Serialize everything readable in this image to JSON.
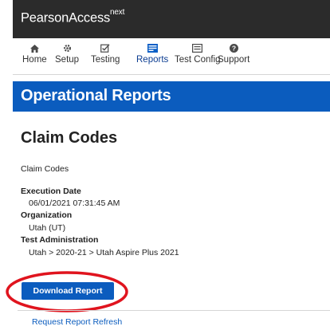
{
  "header": {
    "brand_main": "PearsonAccess",
    "brand_sup": "next",
    "bg_color": "#2b2b2b"
  },
  "nav": {
    "items": [
      {
        "label": "Home",
        "icon": "home-icon"
      },
      {
        "label": "Setup",
        "icon": "gear-icon"
      },
      {
        "label": "Testing",
        "icon": "checkbox-icon"
      },
      {
        "label": "Reports",
        "icon": "report-icon",
        "active": true
      },
      {
        "label": "Test Config",
        "icon": "list-icon"
      },
      {
        "label": "Support",
        "icon": "help-icon"
      }
    ]
  },
  "banner": {
    "title": "Operational Reports",
    "bg_color": "#0b5cbe"
  },
  "report": {
    "title": "Claim Codes",
    "subtitle": "Claim Codes",
    "execution_date_label": "Execution Date",
    "execution_date_value": "06/01/2021 07:31:45 AM",
    "organization_label": "Organization",
    "organization_value": "Utah (UT)",
    "test_admin_label": "Test Administration",
    "test_admin_value": "Utah > 2020-21 > Utah Aspire Plus 2021"
  },
  "actions": {
    "download_label": "Download Report",
    "refresh_label": "Request Report Refresh",
    "highlight_color": "#e0141e"
  }
}
